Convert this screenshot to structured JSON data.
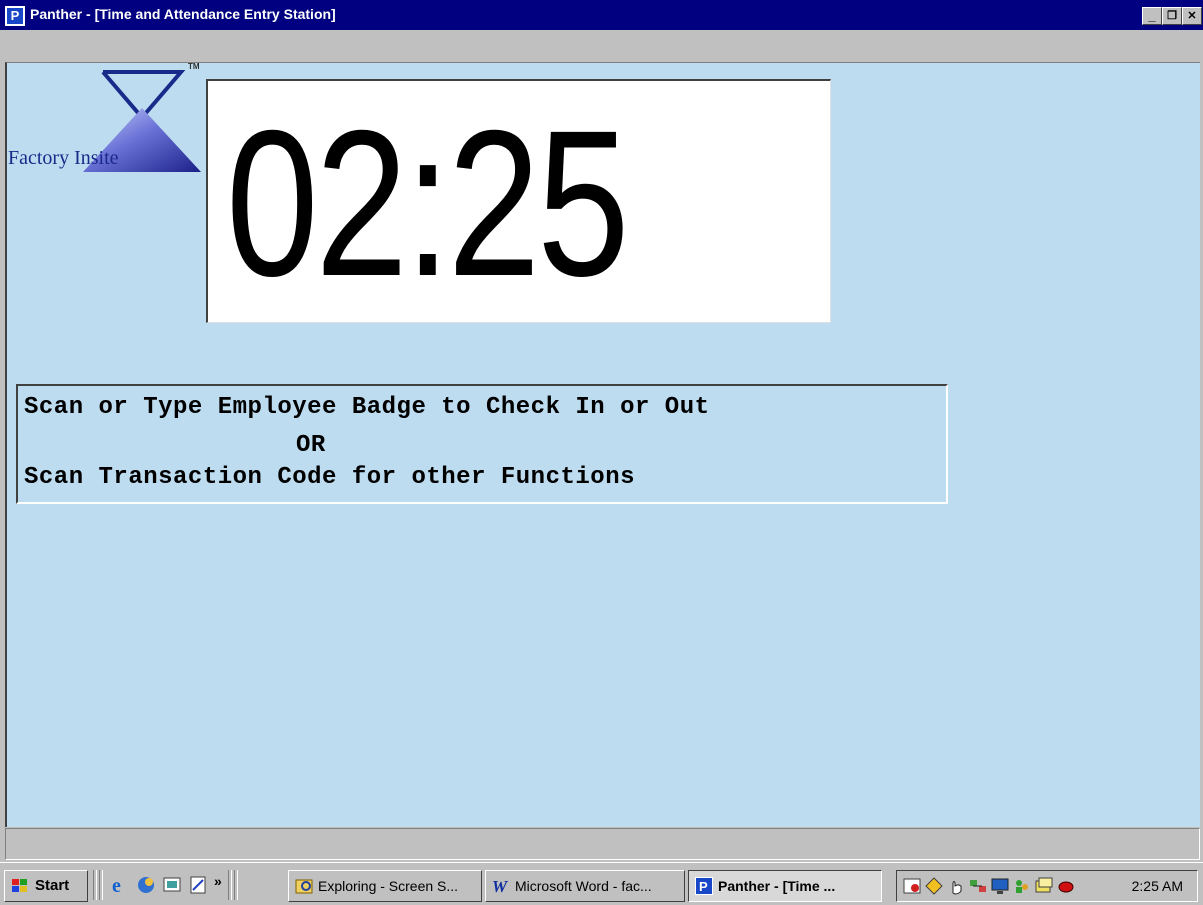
{
  "window": {
    "title": "Panther - [Time and Attendance Entry Station]",
    "app_icon_letter": "P",
    "minimize_label": "_",
    "restore_label": "❐",
    "close_label": "✕"
  },
  "logo": {
    "text": "Factory Insite",
    "tm": "TM"
  },
  "clock": {
    "value": "02:25"
  },
  "instructions": {
    "line1": "Scan or Type Employee Badge to Check In or Out",
    "line2": "OR",
    "line3": "Scan Transaction Code for other Functions"
  },
  "taskbar": {
    "start_label": "Start",
    "more_label": "»",
    "quick_launch_icons": [
      "internet-explorer-icon",
      "outlook-express-icon",
      "show-desktop-icon",
      "notepad-icon"
    ],
    "tasks": [
      {
        "label": "Exploring - Screen S...",
        "icon": "explorer-icon",
        "active": false
      },
      {
        "label": "Microsoft Word - fac...",
        "icon": "word-icon",
        "active": false
      },
      {
        "label": "Panther - [Time ...",
        "icon": "panther-icon",
        "active": true
      }
    ],
    "tray_icons": [
      "scheduler-icon",
      "diamond-icon",
      "hand-icon",
      "network-icon",
      "monitor-icon",
      "people-icon",
      "window-icon",
      "record-icon"
    ],
    "time": "2:25 AM"
  },
  "colors": {
    "titlebar": "#000080",
    "client_background": "#bedcf0",
    "clock_background": "#ffffff",
    "chrome": "#c0c0c0"
  }
}
